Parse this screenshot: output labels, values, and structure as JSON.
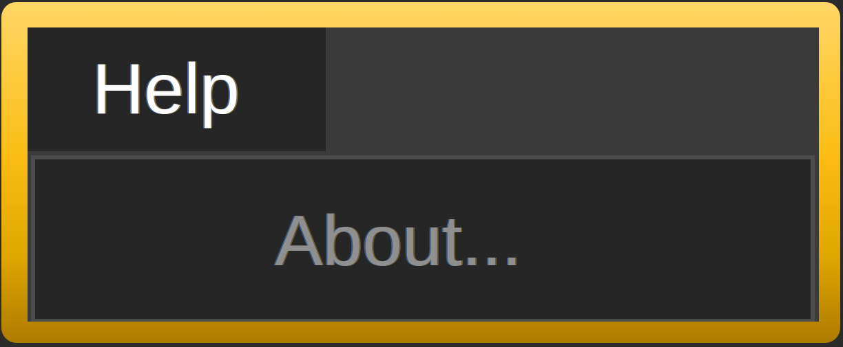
{
  "menubar": {
    "help_label": "Help"
  },
  "dropdown": {
    "about_label": "About..."
  },
  "colors": {
    "frame_highlight": "#fbbd14",
    "menu_background": "#262626",
    "menubar_background": "#3a3a3a",
    "active_text": "#ffffff",
    "disabled_text": "#8f8f8f"
  }
}
